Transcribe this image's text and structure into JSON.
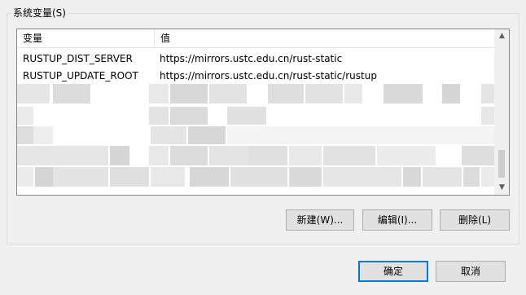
{
  "group": {
    "title": "系统变量(S)"
  },
  "table": {
    "headers": {
      "variable": "变量",
      "value": "值"
    },
    "rows": [
      {
        "variable": "RUSTUP_DIST_SERVER",
        "value": "https://mirrors.ustc.edu.cn/rust-static"
      },
      {
        "variable": "RUSTUP_UPDATE_ROOT",
        "value": "https://mirrors.ustc.edu.cn/rust-static/rustup"
      }
    ]
  },
  "icons": {
    "scroll_up": "chevron-up-icon",
    "scroll_down": "chevron-down-icon"
  },
  "buttons": {
    "new": "新建(W)...",
    "edit": "编辑(I)...",
    "delete": "删除(L)",
    "ok": "确定",
    "cancel": "取消"
  },
  "colors": {
    "accent": "#0078d7",
    "button_bg": "#e1e1e1",
    "window_bg": "#f0f0f0"
  }
}
